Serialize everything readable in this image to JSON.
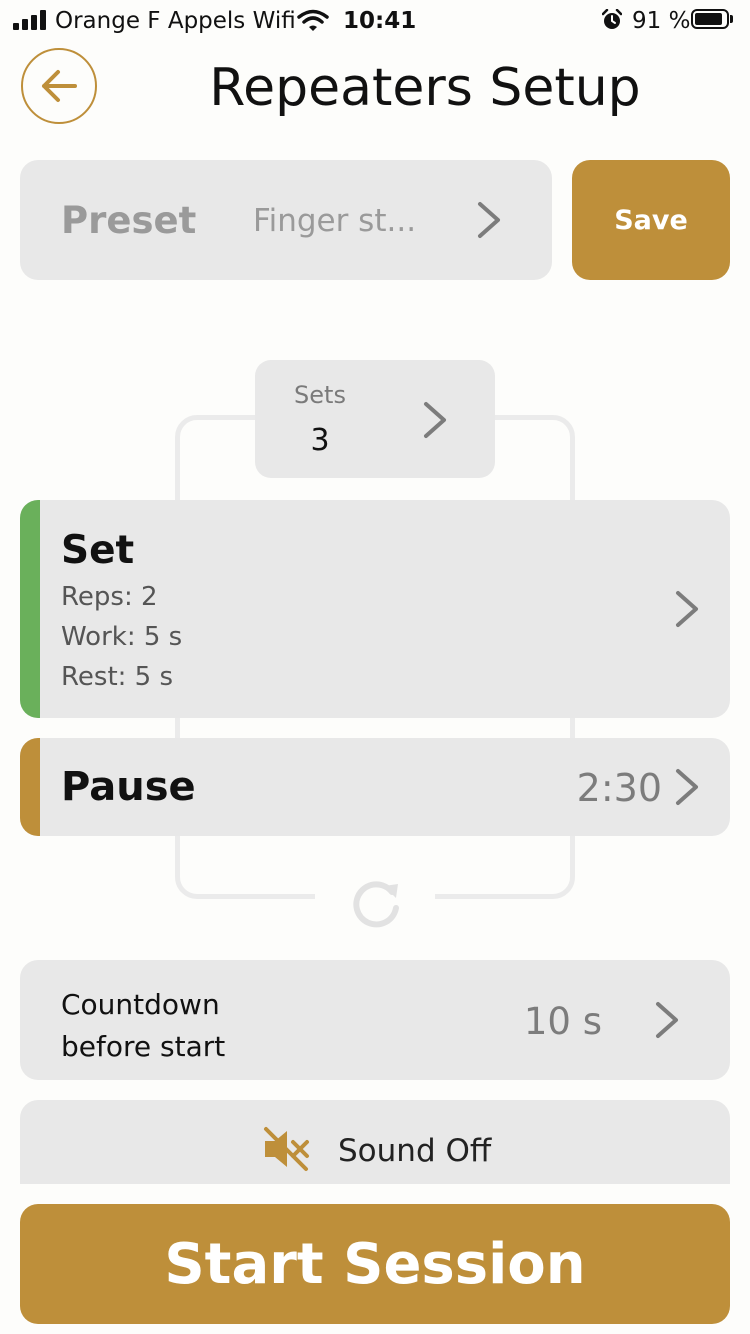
{
  "status_bar": {
    "carrier": "Orange F Appels Wifi",
    "time": "10:41",
    "battery_percent": "91 %"
  },
  "header": {
    "title": "Repeaters Setup"
  },
  "preset": {
    "label": "Preset",
    "value": "Finger st..."
  },
  "save_label": "Save",
  "sets": {
    "label": "Sets",
    "value": "3"
  },
  "set_block": {
    "title": "Set",
    "reps": "Reps: 2",
    "work": "Work: 5 s",
    "rest": "Rest: 5 s",
    "accent_color": "#6ab05b"
  },
  "pause_block": {
    "title": "Pause",
    "value": "2:30",
    "accent_color": "#be8f3a"
  },
  "countdown": {
    "label_line1": "Countdown",
    "label_line2": "before start",
    "value": "10 s"
  },
  "sound": {
    "label": "Sound Off",
    "icon": "speaker-muted-icon"
  },
  "start_label": "Start Session",
  "colors": {
    "accent": "#be8f3a",
    "card_bg": "#e8e8e8",
    "green": "#6ab05b"
  }
}
